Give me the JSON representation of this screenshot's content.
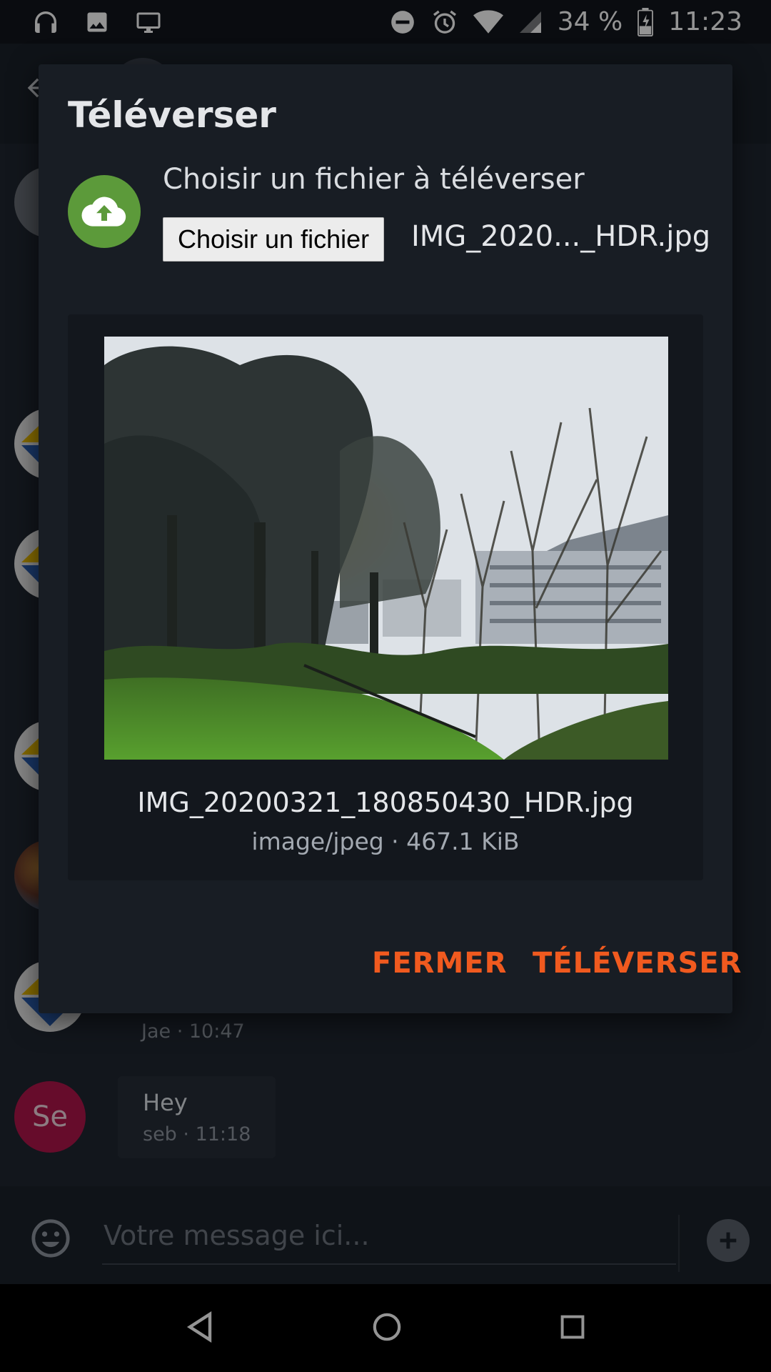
{
  "status_bar": {
    "battery": "34 %",
    "time": "11:23"
  },
  "chat": {
    "messages": [
      {
        "meta": "Jae · 10:47"
      },
      {
        "avatar_initials": "Se",
        "text": "Hey",
        "meta": "seb · 11:18"
      }
    ],
    "composer": {
      "placeholder": "Votre message ici..."
    }
  },
  "dialog": {
    "title": "Téléverser",
    "prompt": "Choisir un fichier à téléverser",
    "choose_button": "Choisir un fichier",
    "chosen_file": "IMG_2020..._HDR.jpg",
    "preview": {
      "file_name": "IMG_20200321_180850430_HDR.jpg",
      "file_meta": "image/jpeg · 467.1 KiB"
    },
    "actions": {
      "close": "FERMER",
      "upload": "TÉLÉVERSER"
    }
  },
  "colors": {
    "accent": "#f05a1f",
    "upload_icon_bg": "#5c9a3a",
    "dialog_bg": "#181d24",
    "avatar_se": "#b0164a"
  },
  "icons": {
    "status_left": [
      "headphones-icon",
      "image-icon",
      "monitor-icon"
    ],
    "status_right": [
      "dnd-icon",
      "alarm-icon",
      "wifi-icon",
      "signal-icon",
      "battery-icon"
    ],
    "dialog": "cloud-upload-icon",
    "composer": [
      "emoji-icon",
      "plus-icon"
    ],
    "nav": [
      "back-nav-icon",
      "home-nav-icon",
      "recents-nav-icon"
    ]
  }
}
